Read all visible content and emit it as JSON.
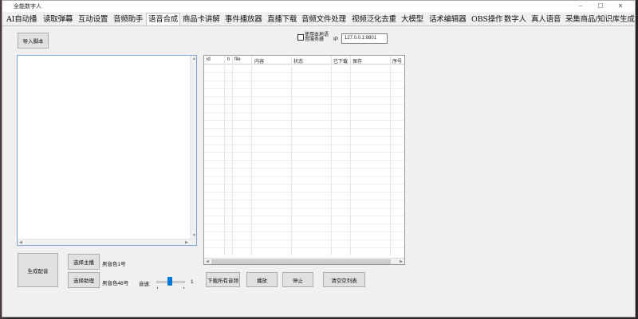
{
  "window": {
    "title": "全能数字人",
    "minimize": "–",
    "maximize": "☐",
    "close": "✕"
  },
  "tabs": [
    {
      "label": "AI自动播"
    },
    {
      "label": "读取弹幕"
    },
    {
      "label": "互动设置"
    },
    {
      "label": "音频助手"
    },
    {
      "label": "语音合成",
      "active": true
    },
    {
      "label": "商品卡讲解"
    },
    {
      "label": "事件播放器"
    },
    {
      "label": "直播下载"
    },
    {
      "label": "音频文件处理"
    },
    {
      "label": "视频泛化去重"
    },
    {
      "label": "大模型"
    },
    {
      "label": "话术编辑器"
    },
    {
      "label": "OBS操作"
    },
    {
      "label": "数字人"
    },
    {
      "label": "真人语音"
    },
    {
      "label": "采集商品/知识库生成"
    }
  ],
  "script_panel": {
    "import_button": "导入脚本",
    "text": ""
  },
  "server": {
    "use_local_label": "使用本地语音服务器",
    "checked": false,
    "ip_label": "IP",
    "ip_value": "127.0.0.1:8801"
  },
  "table": {
    "columns": [
      "id",
      "h",
      "file",
      "内容",
      "状态",
      "已下载",
      "保存",
      "序号"
    ],
    "rows": []
  },
  "controls": {
    "generate_button": "生成配音",
    "choose_host_button": "选择主播",
    "host_voice": "男音色1号",
    "choose_assistant_button": "选择助理",
    "assistant_voice": "男音色48号",
    "speed_label": "音速:",
    "speed_value": "1",
    "speed_level": 0.45,
    "download_all_button": "下载所有音频",
    "play_button": "播放",
    "stop_button": "停止",
    "clear_button": "清空空列表"
  }
}
